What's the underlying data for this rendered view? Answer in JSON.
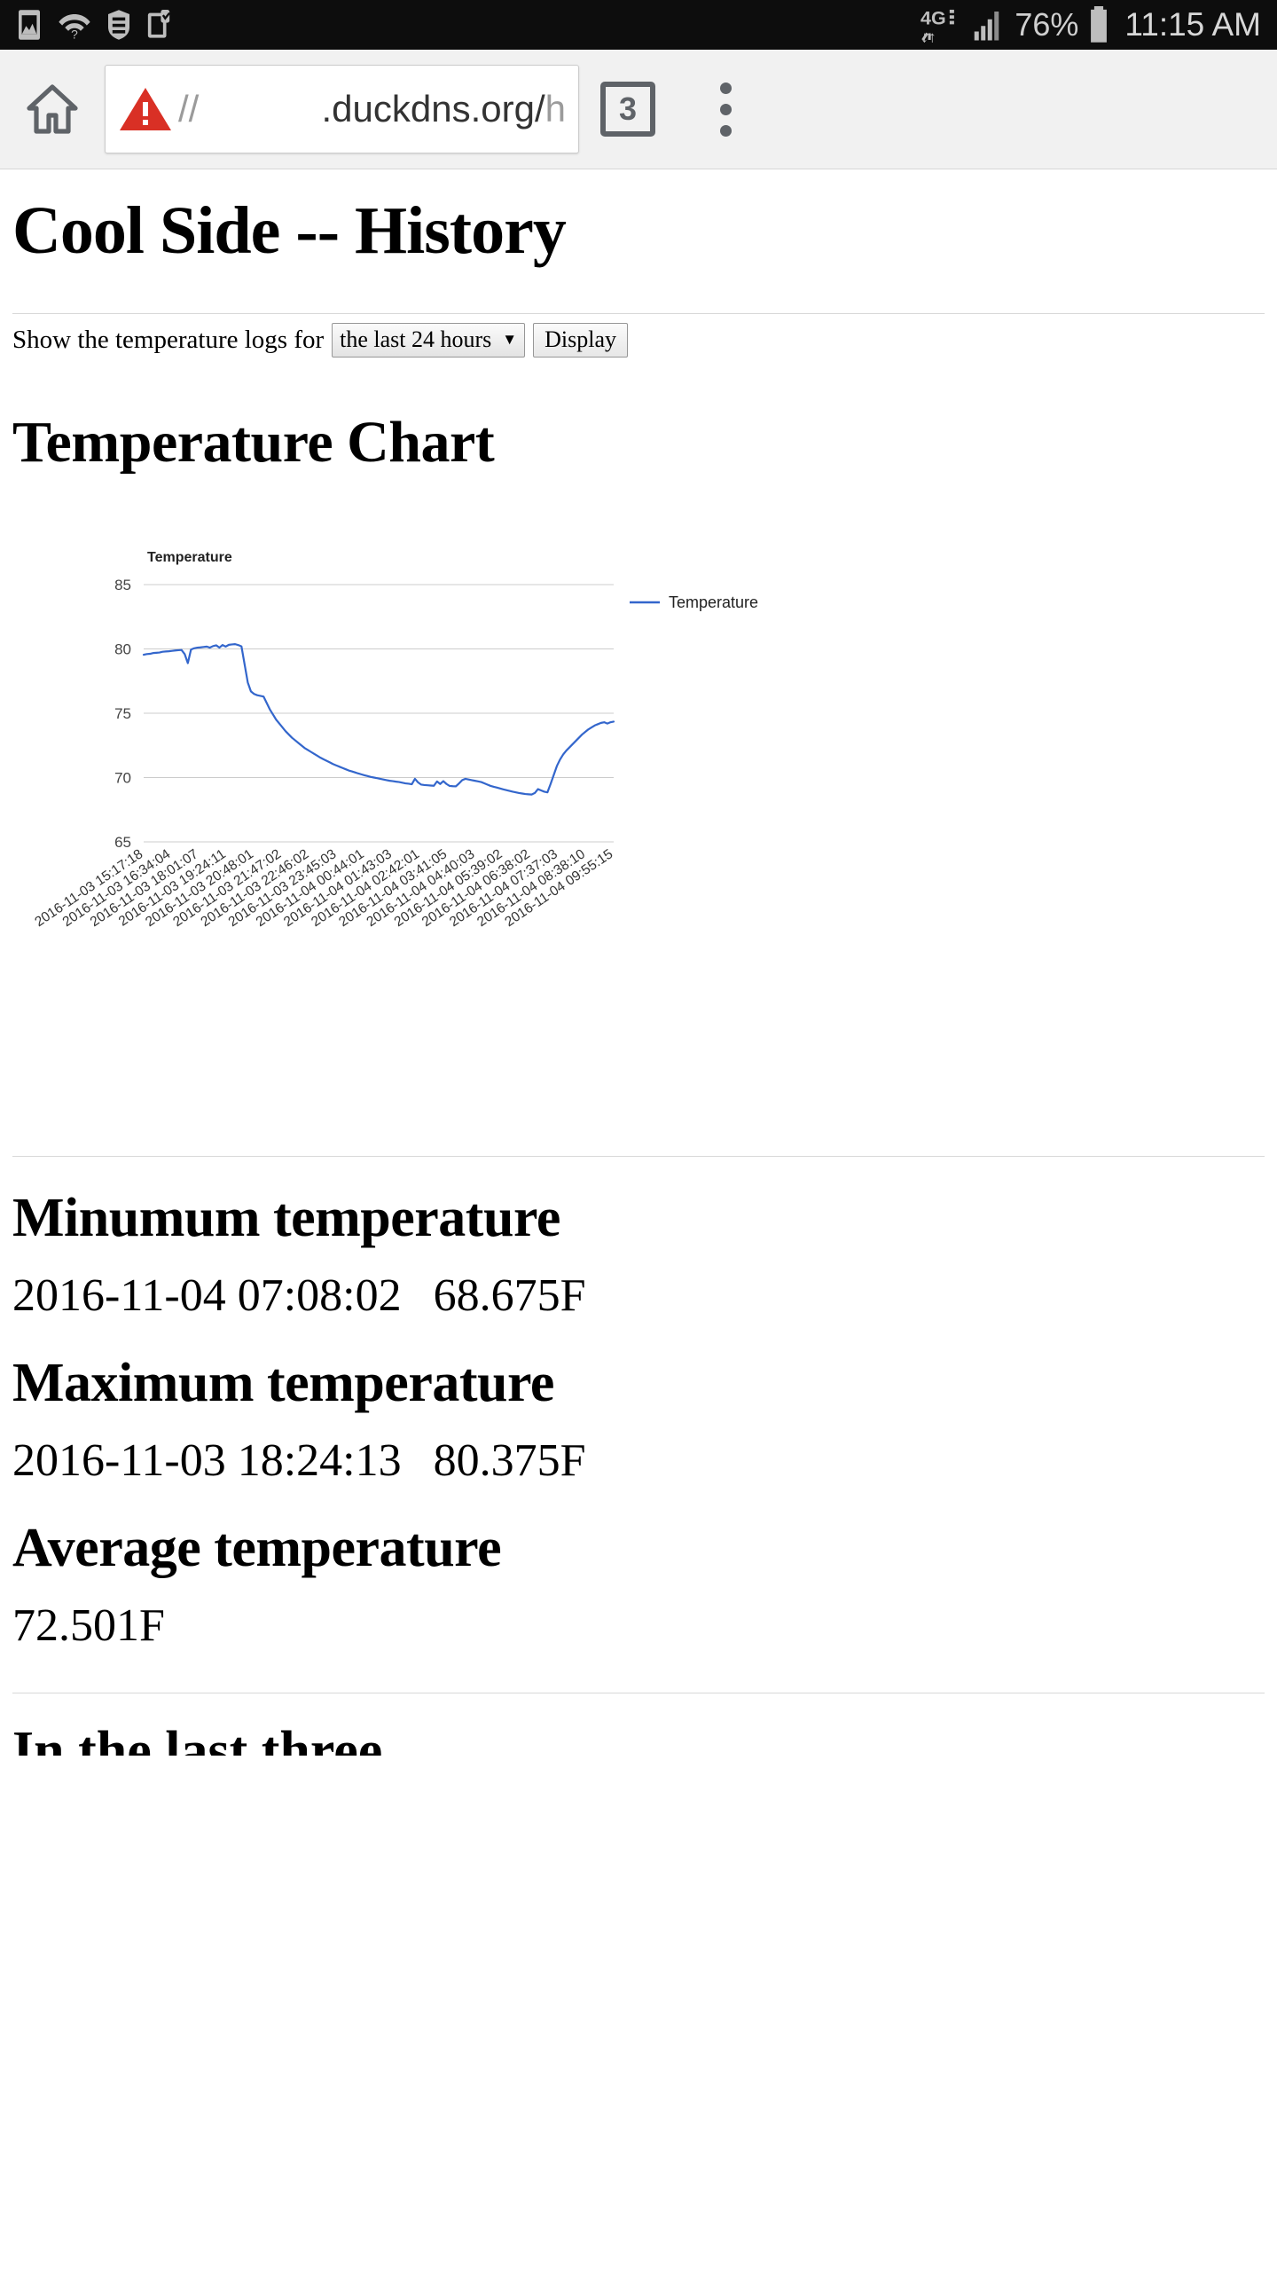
{
  "status_bar": {
    "icons_left": [
      "image-icon",
      "wifi-question-icon",
      "vpn-key-icon",
      "clipboard-check-icon"
    ],
    "network_type": "4G",
    "battery_percent": "76%",
    "time": "11:15 AM"
  },
  "browser": {
    "home_icon": "home-icon",
    "security_icon": "warning-triangle-icon",
    "url_scheme": "//",
    "url_host": ".duckdns.org/",
    "url_path_fragment": "h",
    "tab_count": "3",
    "menu_icon": "overflow-menu-icon"
  },
  "page": {
    "title": "Cool Side -- History",
    "form": {
      "label": "Show the temperature logs for",
      "select_value": "the last 24 hours",
      "select_options": [
        "the last 24 hours"
      ],
      "caret": "▼",
      "display_button": "Display"
    },
    "chart_heading": "Temperature Chart",
    "stats": [
      {
        "heading": "Minumum temperature",
        "timestamp": "2016-11-04 07:08:02",
        "value": "68.675F"
      },
      {
        "heading": "Maximum temperature",
        "timestamp": "2016-11-03 18:24:13",
        "value": "80.375F"
      },
      {
        "heading": "Average temperature",
        "timestamp": "",
        "value": "72.501F"
      }
    ],
    "next_heading_partial": "In the last three"
  },
  "chart_data": {
    "type": "line",
    "title": "Temperature",
    "xlabel": "",
    "ylabel": "",
    "ylim": [
      65,
      85
    ],
    "yticks": [
      65,
      70,
      75,
      80,
      85
    ],
    "grid": true,
    "legend": {
      "position": "right",
      "entries": [
        "Temperature"
      ]
    },
    "series_color": "#3366cc",
    "categories": [
      "2016-11-03 15:17:18",
      "2016-11-03 16:34:04",
      "2016-11-03 18:01:07",
      "2016-11-03 19:24:11",
      "2016-11-03 20:48:01",
      "2016-11-03 21:47:02",
      "2016-11-03 22:46:02",
      "2016-11-03 23:45:03",
      "2016-11-04 00:44:01",
      "2016-11-04 01:43:03",
      "2016-11-04 02:42:01",
      "2016-11-04 03:41:05",
      "2016-11-04 04:40:03",
      "2016-11-04 05:39:02",
      "2016-11-04 06:38:02",
      "2016-11-04 07:37:03",
      "2016-11-04 08:38:10",
      "2016-11-04 09:55:15"
    ],
    "series": [
      {
        "name": "Temperature",
        "values": [
          79.55,
          79.6,
          79.62,
          79.68,
          79.7,
          79.72,
          79.78,
          79.8,
          79.82,
          79.85,
          79.88,
          79.9,
          79.92,
          79.6,
          78.9,
          79.95,
          80.05,
          80.1,
          80.12,
          80.15,
          80.18,
          80.1,
          80.22,
          80.28,
          80.1,
          80.3,
          80.18,
          80.32,
          80.35,
          80.37,
          80.3,
          80.2,
          78.8,
          77.4,
          76.7,
          76.5,
          76.4,
          76.35,
          76.3,
          75.8,
          75.3,
          74.9,
          74.5,
          74.2,
          73.9,
          73.6,
          73.35,
          73.1,
          72.9,
          72.7,
          72.5,
          72.3,
          72.15,
          72.0,
          71.85,
          71.7,
          71.55,
          71.42,
          71.3,
          71.18,
          71.05,
          70.95,
          70.85,
          70.75,
          70.65,
          70.55,
          70.48,
          70.4,
          70.32,
          70.25,
          70.18,
          70.12,
          70.05,
          70.0,
          69.95,
          69.9,
          69.85,
          69.8,
          69.75,
          69.72,
          69.68,
          69.65,
          69.6,
          69.55,
          69.52,
          69.48,
          69.9,
          69.62,
          69.45,
          69.42,
          69.4,
          69.38,
          69.36,
          69.7,
          69.5,
          69.72,
          69.5,
          69.35,
          69.33,
          69.32,
          69.55,
          69.8,
          69.9,
          69.85,
          69.8,
          69.75,
          69.7,
          69.65,
          69.55,
          69.45,
          69.35,
          69.28,
          69.22,
          69.15,
          69.08,
          69.02,
          68.96,
          68.9,
          68.85,
          68.8,
          68.76,
          68.72,
          68.7,
          68.68,
          68.8,
          69.1,
          69.0,
          68.9,
          68.85,
          69.5,
          70.2,
          70.9,
          71.4,
          71.8,
          72.1,
          72.35,
          72.6,
          72.85,
          73.1,
          73.35,
          73.55,
          73.75,
          73.9,
          74.05,
          74.15,
          74.25,
          74.3,
          74.2,
          74.3,
          74.35
        ]
      }
    ]
  }
}
